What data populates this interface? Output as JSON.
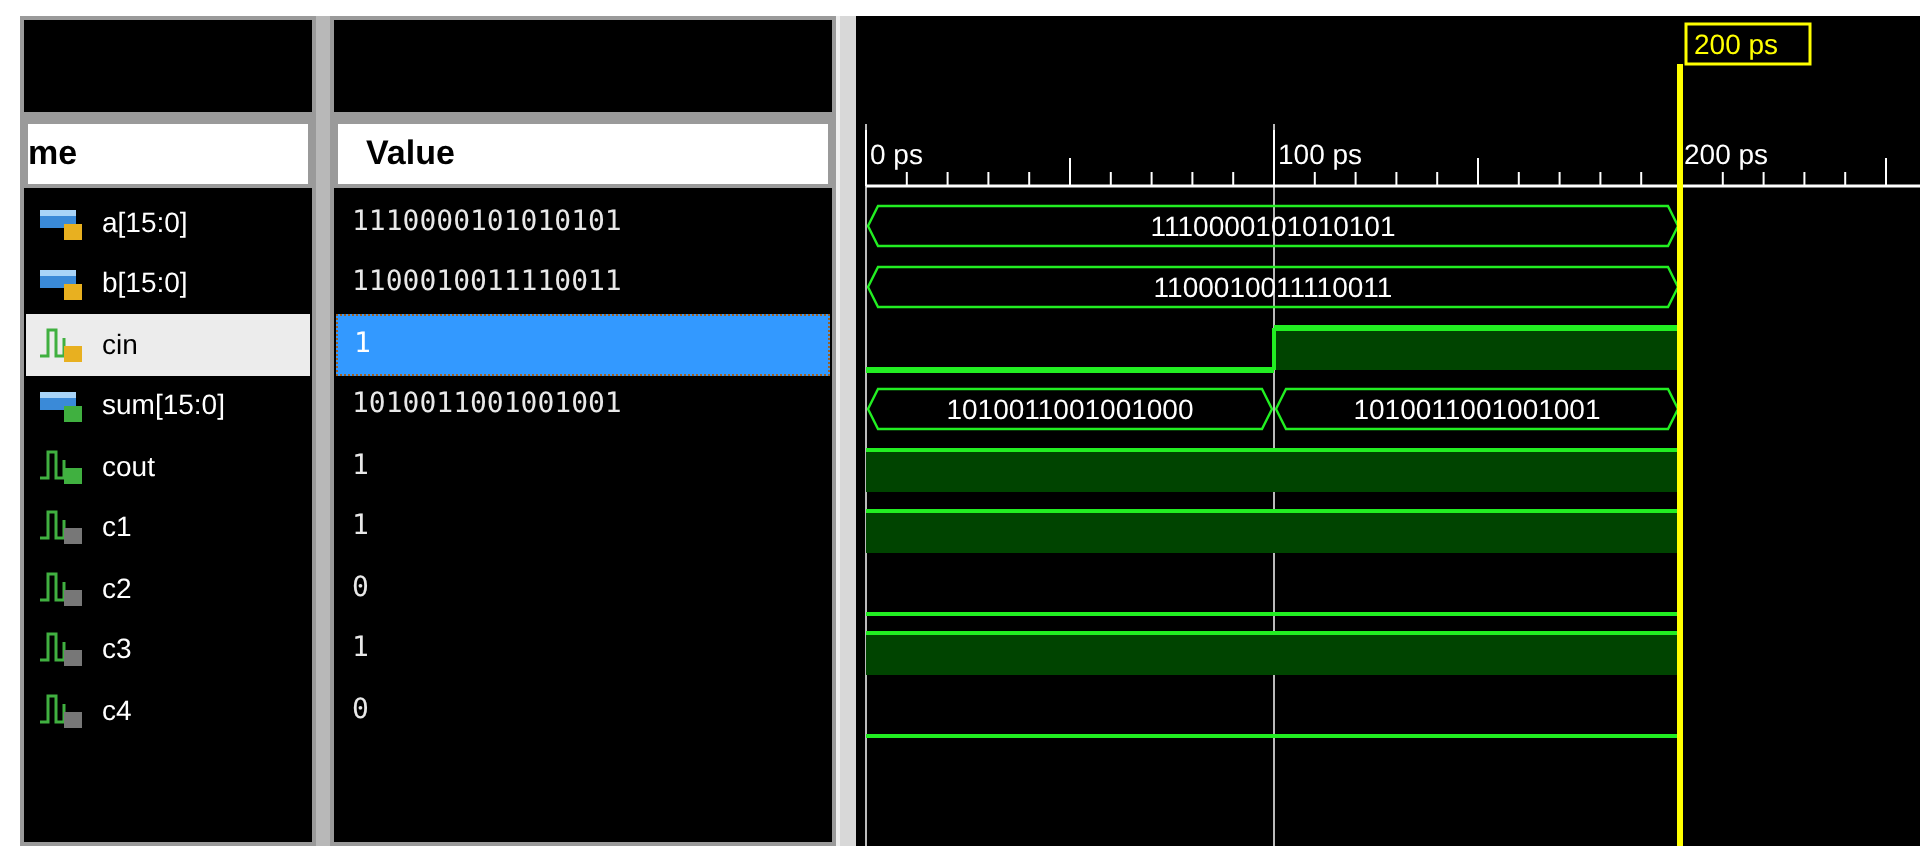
{
  "name_column": {
    "header": "me"
  },
  "value_column": {
    "header": "Value"
  },
  "cursor": {
    "label": "200 ps"
  },
  "ruler": {
    "labels": [
      "0 ps",
      "100 ps",
      "200 ps"
    ]
  },
  "signals": [
    {
      "name": "a[15:0]",
      "kind": "bus",
      "color": "#e8b020",
      "value": "1110000101010101",
      "selected": false,
      "segments": [
        {
          "value": "1110000101010101",
          "to_cursor": true
        }
      ]
    },
    {
      "name": "b[15:0]",
      "kind": "bus",
      "color": "#e8b020",
      "value": "1100010011110011",
      "selected": false,
      "segments": [
        {
          "value": "1100010011110011",
          "to_cursor": true
        }
      ]
    },
    {
      "name": "cin",
      "kind": "bit",
      "color": "#e8b020",
      "value": "1",
      "selected": true,
      "segments": [
        {
          "high": false,
          "to_cursor": false
        },
        {
          "high": true,
          "to_cursor": true
        }
      ]
    },
    {
      "name": "sum[15:0]",
      "kind": "bus",
      "color": "#40b040",
      "value": "1010011001001001",
      "selected": false,
      "segments": [
        {
          "value": "1010011001001000",
          "to_cursor": false
        },
        {
          "value": "1010011001001001",
          "to_cursor": true
        }
      ]
    },
    {
      "name": "cout",
      "kind": "bit",
      "color": "#40b040",
      "value": "1",
      "selected": false,
      "segments": [
        {
          "high": true,
          "to_cursor": true
        }
      ]
    },
    {
      "name": "c1",
      "kind": "bit",
      "color": "#777777",
      "value": "1",
      "selected": false,
      "segments": [
        {
          "high": true,
          "to_cursor": true
        }
      ]
    },
    {
      "name": "c2",
      "kind": "bit",
      "color": "#777777",
      "value": "0",
      "selected": false,
      "segments": [
        {
          "high": false,
          "to_cursor": true
        }
      ]
    },
    {
      "name": "c3",
      "kind": "bit",
      "color": "#777777",
      "value": "1",
      "selected": false,
      "segments": [
        {
          "high": true,
          "to_cursor": true
        }
      ]
    },
    {
      "name": "c4",
      "kind": "bit",
      "color": "#777777",
      "value": "0",
      "selected": false,
      "segments": [
        {
          "high": false,
          "to_cursor": true
        }
      ]
    }
  ]
}
